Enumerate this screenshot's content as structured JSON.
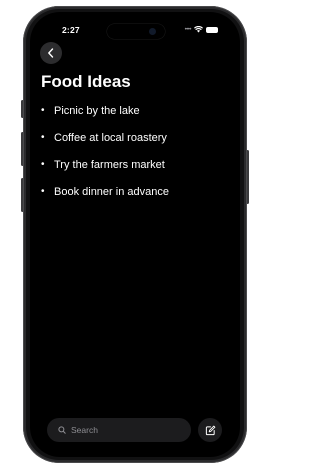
{
  "status_bar": {
    "time": "2:27",
    "signal_icon": "cellular-dots-icon",
    "wifi_icon": "wifi-icon",
    "battery_icon": "battery-icon"
  },
  "nav": {
    "back_icon": "chevron-left-icon"
  },
  "note": {
    "title": "Food Ideas",
    "items": [
      "Picnic by the lake",
      "Coffee at local roastery",
      "Try the farmers market",
      "Book dinner in advance"
    ]
  },
  "bottom_bar": {
    "search_placeholder": "Search",
    "search_icon": "search-icon",
    "compose_icon": "compose-icon"
  },
  "colors": {
    "background": "#000000",
    "text": "#ffffff",
    "control_bg": "#1c1c1e",
    "secondary_text": "#8e8e93"
  }
}
